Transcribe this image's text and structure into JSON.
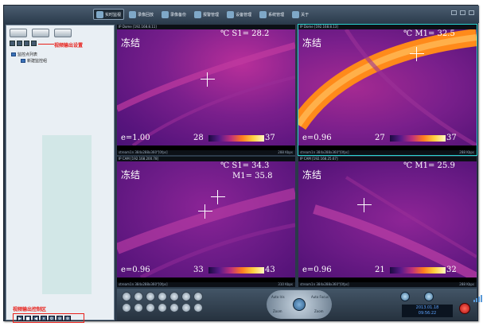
{
  "menu": {
    "items": [
      {
        "label": "实时监视",
        "active": true
      },
      {
        "label": "录像回放",
        "active": false
      },
      {
        "label": "录像备份",
        "active": false
      },
      {
        "label": "报警管理",
        "active": false
      },
      {
        "label": "设备管理",
        "active": false
      },
      {
        "label": "系统管理",
        "active": false
      },
      {
        "label": "关于",
        "active": false
      }
    ]
  },
  "left": {
    "annotation_top": "视频输出设置",
    "annotation_bottom": "视频输出控制区",
    "tree": {
      "root": "监控点列表",
      "child": "新建监控组"
    },
    "controls": [
      "▶",
      "■",
      "◀",
      "⏸",
      "⚙",
      "⊕",
      "⊗"
    ]
  },
  "panes": [
    {
      "header": "IP Dome [192.168.8.11]",
      "footer_left": "stream1n 384x288x360\"[0fps]",
      "footer_right": "288 Kbps",
      "name_label": "冻结",
      "unit": "℃",
      "spot_label": "S1=",
      "spot_value": "28.2",
      "emissivity": "e=1.00",
      "range_min": "28",
      "range_max": "37"
    },
    {
      "header": "IP Dome [192.168.8.13]",
      "footer_left": "stream1n 384x288x360\"[0fps]",
      "footer_right": "288 Kbps",
      "name_label": "冻结",
      "unit": "℃",
      "spot_label": "M1=",
      "spot_value": "32.5",
      "emissivity": "e=0.96",
      "range_min": "27",
      "range_max": "37"
    },
    {
      "header": "IP CAM [192.168.200.78]",
      "footer_left": "stream1n 384x288x360\"[0fps]",
      "footer_right": "310 Kbps",
      "name_label": "冻结",
      "unit": "℃",
      "spot_label": "S1=",
      "spot_value": "34.3",
      "spot2_label": "M1=",
      "spot2_value": "35.8",
      "emissivity": "e=0.96",
      "range_min": "33",
      "range_max": "43"
    },
    {
      "header": "IP CAM [192.168.25.67]",
      "footer_left": "stream1n 384x288x360\"[0fps]",
      "footer_right": "288 Kbps",
      "name_label": "冻结",
      "unit": "℃",
      "spot_label": "M1=",
      "spot_value": "25.9",
      "emissivity": "e=0.96",
      "range_min": "21",
      "range_max": "32"
    }
  ],
  "ptz": {
    "top_left": "Auto Iris",
    "top_right": "Auto Focus",
    "bottom_left": "Zoom",
    "bottom_right": "Zoom"
  },
  "clock": {
    "date": "2013.01.18",
    "time": "09:56:22"
  }
}
